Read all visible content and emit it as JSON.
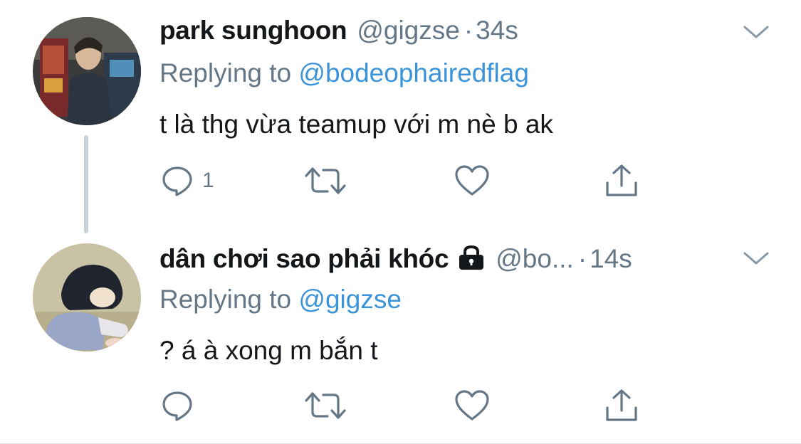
{
  "tweets": [
    {
      "name": "park sunghoon",
      "handle": "@gigzse",
      "separator": "·",
      "time": "34s",
      "replying_prefix": "Replying to ",
      "replying_to": "@bodeophairedflag",
      "text": "t là thg vừa teamup với m nè b ak",
      "reply_count": "1",
      "protected": false
    },
    {
      "name": "dân chơi sao phải khóc",
      "handle": "@bo...",
      "separator": "·",
      "time": "14s",
      "replying_prefix": "Replying to ",
      "replying_to": "@gigzse",
      "text": "? á à xong m bắn t",
      "reply_count": "",
      "protected": true
    }
  ],
  "icons": {
    "reply": "reply-icon",
    "retweet": "retweet-icon",
    "like": "like-icon",
    "share": "share-icon",
    "more": "chevron-down-icon",
    "lock": "lock-icon"
  },
  "colors": {
    "name": "#14171a",
    "muted": "#657786",
    "link": "#3b94d9",
    "thread_line": "#c9d1d8"
  }
}
